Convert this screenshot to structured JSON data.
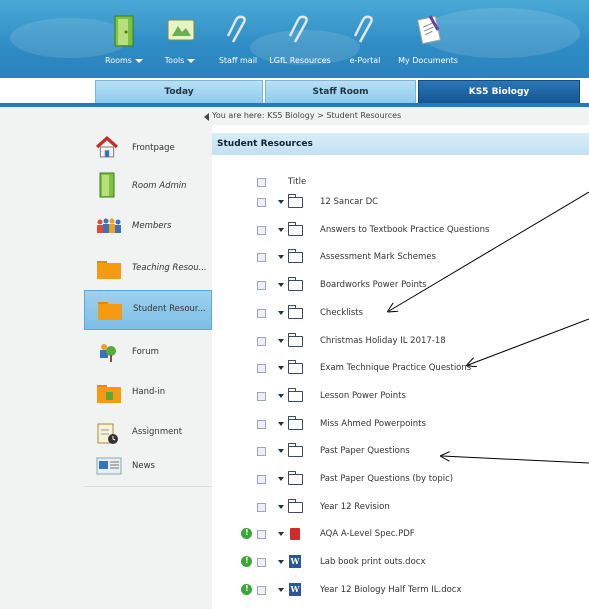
{
  "toolbar": {
    "rooms_label": "Rooms",
    "tools_label": "Tools",
    "staff_mail_label": "Staff mail",
    "lgfl_label": "LGfL Resources",
    "eportal_label": "e-Portal",
    "docs_label": "My Documents"
  },
  "tabs": {
    "today": "Today",
    "staff_room": "Staff Room",
    "ks5": "KS5 Biology"
  },
  "breadcrumb": "You are here: KS5 Biology > Student Resources",
  "sidebar": {
    "items": [
      {
        "label": "Frontpage"
      },
      {
        "label": "Room Admin"
      },
      {
        "label": "Members"
      },
      {
        "label": "Teaching Resou..."
      },
      {
        "label": "Student Resour..."
      },
      {
        "label": "Forum"
      },
      {
        "label": "Hand-in"
      },
      {
        "label": "Assignment"
      },
      {
        "label": "News"
      }
    ]
  },
  "main": {
    "header": "Student Resources",
    "column_title": "Title",
    "rows": [
      {
        "name": "12 Sancar DC",
        "type": "folder"
      },
      {
        "name": "Answers to Textbook Practice Questions",
        "type": "folder"
      },
      {
        "name": "Assessment Mark Schemes",
        "type": "folder"
      },
      {
        "name": "Boardworks Power Points",
        "type": "folder"
      },
      {
        "name": "Checklists",
        "type": "folder"
      },
      {
        "name": "Christmas Holiday IL 2017-18",
        "type": "folder"
      },
      {
        "name": "Exam Technique Practice Questions",
        "type": "folder"
      },
      {
        "name": "Lesson Power Points",
        "type": "folder"
      },
      {
        "name": "Miss Ahmed Powerpoints",
        "type": "folder"
      },
      {
        "name": "Past Paper Questions",
        "type": "folder"
      },
      {
        "name": "Past Paper Questions (by topic)",
        "type": "folder"
      },
      {
        "name": "Year 12 Revision",
        "type": "folder"
      },
      {
        "name": "AQA A-Level Spec.PDF",
        "type": "pdf"
      },
      {
        "name": "Lab book print outs.docx",
        "type": "word"
      },
      {
        "name": "Year 12 Biology Half Term IL.docx",
        "type": "word"
      }
    ]
  },
  "colors": {
    "banner": "#2f8cc4",
    "active_tab": "#1c64a3",
    "inactive_tab": "#a9d8f2",
    "header_bar": "#cfe8f6",
    "selected_nav": "#8ec8ea",
    "status_green": "#39a637",
    "pdf_red": "#d12a2a",
    "word_blue": "#2b5797"
  },
  "icons": {
    "rooms": "door-icon",
    "tools": "tools-icon",
    "staff_mail": "paperclip-icon",
    "lgfl": "paperclip-icon",
    "eportal": "paperclip-icon",
    "docs": "document-icon"
  }
}
